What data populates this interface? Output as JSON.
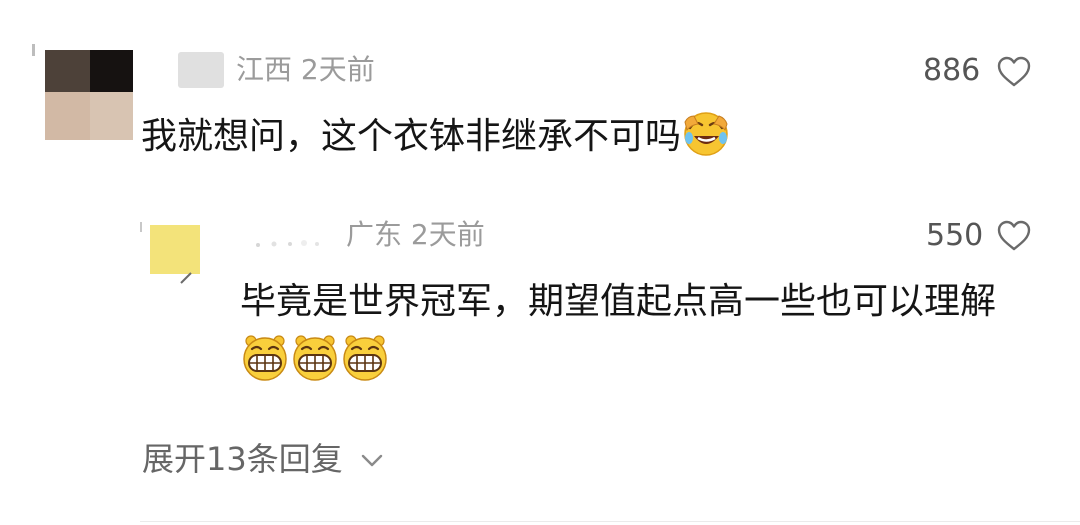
{
  "comment": {
    "location": "江西",
    "time": "2天前",
    "likes": "886",
    "text": "我就想问，这个衣钵非继承不可吗",
    "emoji": "laughing-crying-emoji"
  },
  "reply": {
    "location": "广东",
    "time": "2天前",
    "likes": "550",
    "text": "毕竟是世界冠军，期望值起点高一些也可以理解",
    "emojis": [
      "grinning-emoji",
      "grinning-emoji",
      "grinning-emoji"
    ]
  },
  "expand": {
    "label": "展开13条回复",
    "icon": "chevron-down-icon"
  },
  "colors": {
    "meta": "#9b9b9b",
    "text": "#151515",
    "likes": "#555555"
  }
}
